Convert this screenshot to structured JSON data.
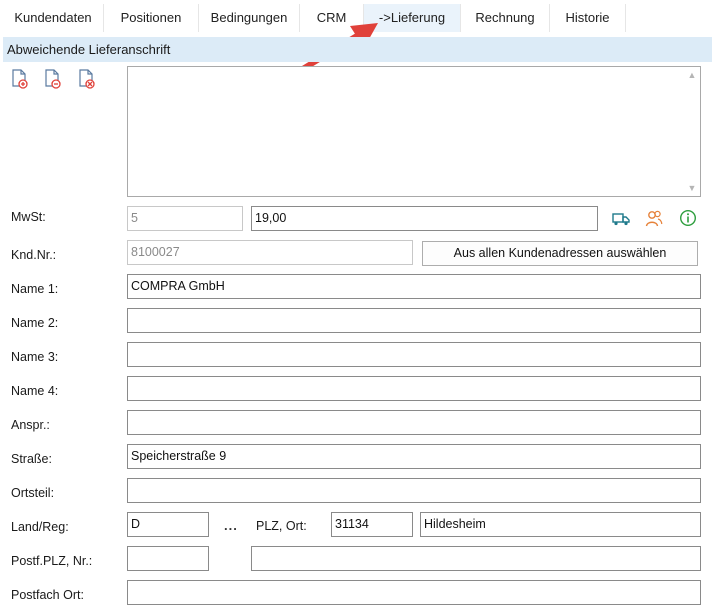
{
  "tabs": [
    {
      "label": "Kundendaten"
    },
    {
      "label": "Positionen"
    },
    {
      "label": "Bedingungen"
    },
    {
      "label": "CRM"
    },
    {
      "label": "->Lieferung",
      "active": true
    },
    {
      "label": "Rechnung"
    },
    {
      "label": "Historie"
    }
  ],
  "section": {
    "title": "Abweichende Lieferanschrift"
  },
  "icons": {
    "doc_icons": [
      "document-add-icon",
      "document-edit-icon",
      "document-delete-icon"
    ],
    "side_icons": [
      "truck-icon",
      "contacts-icon",
      "info-icon"
    ]
  },
  "colors": {
    "accent_red": "#e0413a",
    "tab_active_bg": "#eaf3fb",
    "header_bg": "#dcebf7",
    "green": "#2e9e3e",
    "orange": "#e6823a",
    "teal": "#1f7a8c"
  },
  "form": {
    "mwst": {
      "label": "MwSt:",
      "code": "5",
      "rate": "19,00"
    },
    "kndnr": {
      "label": "Knd.Nr.:",
      "value": "8100027",
      "button": "Aus allen Kundenadressen auswählen"
    },
    "name1": {
      "label": "Name 1:",
      "value": "COMPRA GmbH"
    },
    "name2": {
      "label": "Name 2:",
      "value": ""
    },
    "name3": {
      "label": "Name 3:",
      "value": ""
    },
    "name4": {
      "label": "Name 4:",
      "value": ""
    },
    "anspr": {
      "label": "Anspr.:",
      "value": ""
    },
    "strasse": {
      "label": "Straße:",
      "value": "Speicherstraße 9"
    },
    "ortsteil": {
      "label": "Ortsteil:",
      "value": ""
    },
    "land": {
      "label": "Land/Reg:",
      "value": "D",
      "ellipsis": "...",
      "plz_label": "PLZ, Ort:",
      "plz": "31134",
      "ort": "Hildesheim"
    },
    "postf": {
      "label": "Postf.PLZ, Nr.:",
      "plz": "",
      "nr": ""
    },
    "postfach_ort": {
      "label": "Postfach Ort:",
      "value": ""
    }
  }
}
